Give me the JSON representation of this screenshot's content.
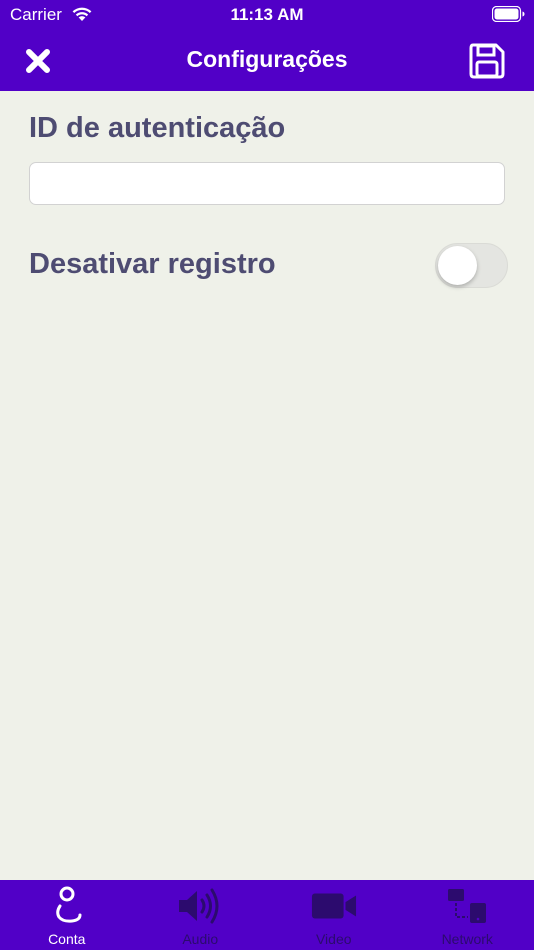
{
  "status_bar": {
    "carrier": "Carrier",
    "time": "11:13 AM"
  },
  "nav": {
    "title": "Configurações",
    "close_icon": "close-icon",
    "save_icon": "save-icon"
  },
  "form": {
    "auth_id_label": "ID de autenticação",
    "auth_id_value": "",
    "auth_id_placeholder": "",
    "disable_registration_label": "Desativar registro",
    "disable_registration_on": false
  },
  "tabs": [
    {
      "label": "Conta",
      "icon": "account-icon",
      "active": true
    },
    {
      "label": "Audio",
      "icon": "speaker-icon",
      "active": false
    },
    {
      "label": "Video",
      "icon": "video-camera-icon",
      "active": false
    },
    {
      "label": "Network",
      "icon": "network-icon",
      "active": false
    }
  ],
  "colors": {
    "brand": "#5100c7",
    "background": "#eff1e9",
    "label_text": "#4e4c72",
    "inactive_tab": "#2c0b6e"
  }
}
